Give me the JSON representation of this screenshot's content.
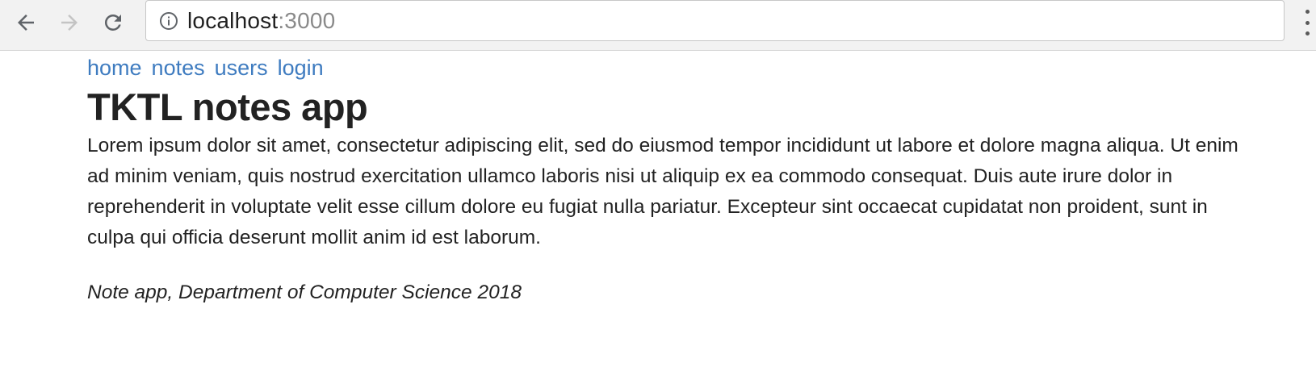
{
  "browser": {
    "url_host": "localhost",
    "url_port": ":3000",
    "back_icon": "back-arrow-icon",
    "forward_icon": "forward-arrow-icon",
    "reload_icon": "reload-icon",
    "info_icon": "info-icon",
    "menu_icon": "kebab-menu-icon"
  },
  "nav": {
    "links": [
      "home",
      "notes",
      "users",
      "login"
    ],
    "link_color": "#3f7cc0"
  },
  "main": {
    "title": "TKTL notes app",
    "lorem": "Lorem ipsum dolor sit amet, consectetur adipiscing elit, sed do eiusmod tempor incididunt ut labore et dolore magna aliqua. Ut enim ad minim veniam, quis nostrud exercitation ullamco laboris nisi ut aliquip ex ea commodo consequat. Duis aute irure dolor in reprehenderit in voluptate velit esse cillum dolore eu fugiat nulla pariatur. Excepteur sint occaecat cupidatat non proident, sunt in culpa qui officia deserunt mollit anim id est laborum."
  },
  "footer": {
    "text": "Note app, Department of Computer Science 2018"
  }
}
